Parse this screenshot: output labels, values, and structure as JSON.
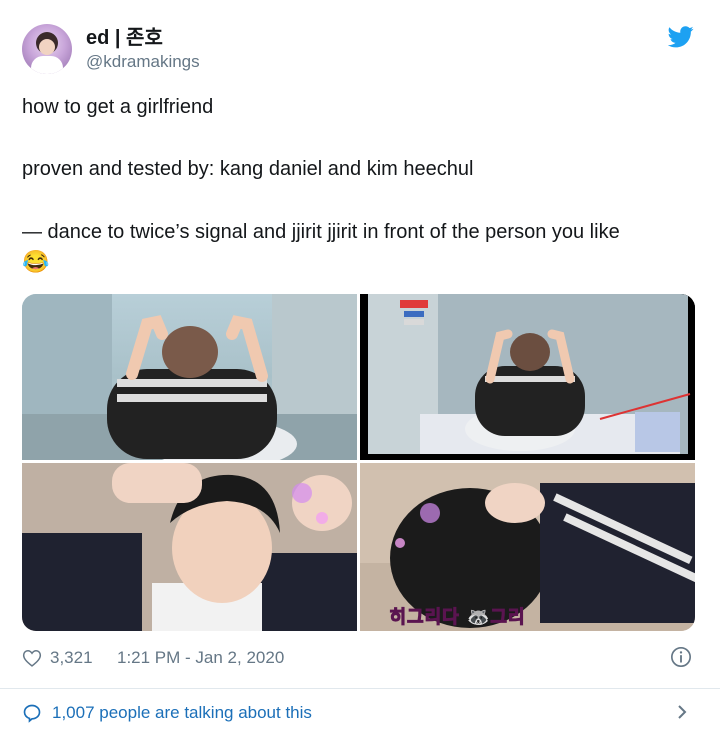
{
  "tweet": {
    "author_name": "ed | 존호",
    "author_handle": "@kdramakings",
    "text_lines": [
      "how to get a girlfriend",
      "proven and tested by: kang daniel and kim heechul",
      "— dance to twice’s signal and jjirit jjirit in front of the person you like"
    ],
    "emoji": "😂",
    "like_count": "3,321",
    "timestamp": "1:21 PM - Jan 2, 2020",
    "talking": "1,007 people are talking about this"
  },
  "media": {
    "caption_text": "히그리다 🦝그리"
  },
  "colors": {
    "twitter_blue": "#1da1f2",
    "link_blue": "#1b6fb8",
    "muted": "#657786"
  },
  "icons": [
    "twitter-bird-icon",
    "heart-icon",
    "info-icon",
    "comment-bubble-icon",
    "chevron-right-icon"
  ]
}
